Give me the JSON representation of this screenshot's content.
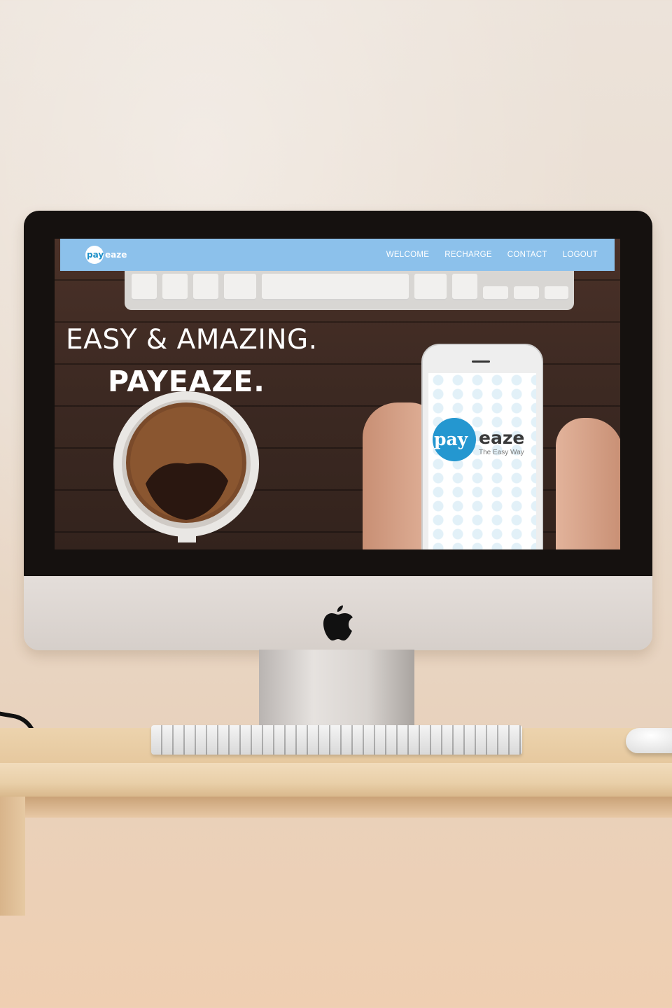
{
  "site": {
    "logo": {
      "pay": "pay",
      "eaze": "eaze"
    },
    "nav": [
      {
        "label": "WELCOME"
      },
      {
        "label": "RECHARGE"
      },
      {
        "label": "CONTACT"
      },
      {
        "label": "LOGOUT"
      }
    ],
    "hero": {
      "headline": "EASY & AMAZING.",
      "subheadline": "PAYEAZE."
    },
    "phone_app": {
      "pay": "pay",
      "eaze": "eaze",
      "tagline": "The Easy Way"
    }
  },
  "colors": {
    "navbar": "#8cc1eb",
    "brand_blue": "#2497d0",
    "hero_text": "#ffffff"
  },
  "icons": [
    "apple-logo-icon"
  ]
}
